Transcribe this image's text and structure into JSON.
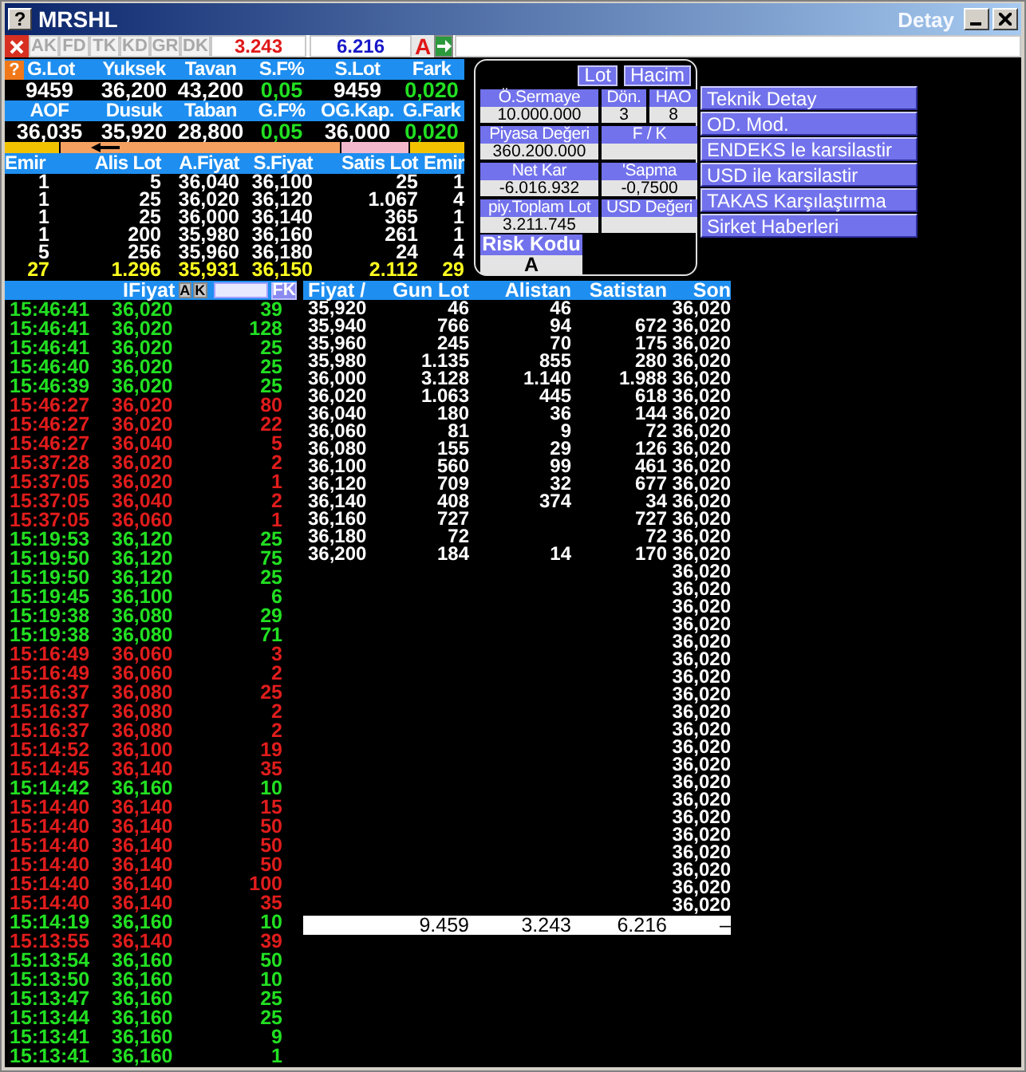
{
  "window": {
    "help": "?",
    "title": "MRSHL",
    "subtitle": "Detay"
  },
  "toolbar": {
    "tabs": [
      {
        "label": "AK",
        "disabled": true
      },
      {
        "label": "FD",
        "disabled": true
      },
      {
        "label": "TK",
        "disabled": true
      },
      {
        "label": "KD",
        "disabled": true
      },
      {
        "label": "GR",
        "disabled": true
      },
      {
        "label": "DK",
        "disabled": true
      }
    ],
    "bid_total": "3.243",
    "ask_total": "6.216",
    "mode": "A"
  },
  "quote": {
    "help": "?",
    "rows": [
      [
        {
          "label": "G.Lot",
          "value": "9459",
          "kind": "plain"
        },
        {
          "label": "Yuksek",
          "value": "36,200",
          "kind": "plain"
        },
        {
          "label": "Tavan",
          "value": "43,200",
          "kind": "plain"
        },
        {
          "label": "S.F%",
          "value": "0,05",
          "kind": "change"
        },
        {
          "label": "S.Lot",
          "value": "9459",
          "kind": "plain"
        },
        {
          "label": "Fark",
          "value": "0,020",
          "kind": "change"
        }
      ],
      [
        {
          "label": "AOF",
          "value": "36,035",
          "kind": "plain"
        },
        {
          "label": "Dusuk",
          "value": "35,920",
          "kind": "plain"
        },
        {
          "label": "Taban",
          "value": "28,800",
          "kind": "plain"
        },
        {
          "label": "G.F%",
          "value": "0,05",
          "kind": "change"
        },
        {
          "label": "OG.Kap.",
          "value": "36,000",
          "kind": "plain"
        },
        {
          "label": "G.Fark",
          "value": "0,020",
          "kind": "change"
        }
      ]
    ]
  },
  "order_book": {
    "columns": [
      "Emir",
      "Alis Lot",
      "A.Fiyat",
      "S.Fiyat",
      "Satis Lot",
      "Emir"
    ],
    "rows": [
      [
        "1",
        "5",
        "36,040",
        "36,100",
        "25",
        "1"
      ],
      [
        "1",
        "25",
        "36,020",
        "36,120",
        "1.067",
        "4"
      ],
      [
        "1",
        "25",
        "36,000",
        "36,140",
        "365",
        "1"
      ],
      [
        "1",
        "200",
        "35,980",
        "36,160",
        "261",
        "1"
      ],
      [
        "5",
        "256",
        "35,960",
        "36,180",
        "24",
        "4"
      ]
    ],
    "totals": [
      "27",
      "1.296",
      "35,931",
      "36,150",
      "2.112",
      "29"
    ]
  },
  "info": {
    "toggles": [
      "Lot",
      "Hacim"
    ],
    "fields": [
      {
        "label": "Ö.Sermaye",
        "value": "10.000.000"
      },
      {
        "label": "Dön.",
        "value": "3"
      },
      {
        "label": "HAO",
        "value": "8"
      },
      {
        "label": "Piyasa Değeri",
        "value": "360.200.000"
      },
      {
        "label": "F / K"
      },
      {
        "label": "Net Kar",
        "value": "-6.016.932"
      },
      {
        "label": "'Sapma",
        "value": "-0,7500"
      },
      {
        "label": "piy.Toplam Lot",
        "value": "3.211.745"
      },
      {
        "label": "USD Değeri"
      }
    ],
    "risk": {
      "label": "Risk Kodu",
      "value": "A"
    }
  },
  "links": [
    "Teknik Detay",
    "OD. Mod.",
    "ENDEKS le karsilastir",
    "USD ile karsilastir",
    "TAKAS Karşılaştırma",
    "Sirket Haberleri"
  ],
  "trades": {
    "header": {
      "label": "IFiyat",
      "buttons": [
        "A",
        "K"
      ],
      "filter": "FK"
    },
    "rows": [
      {
        "time": "15:46:41",
        "price": "36,020",
        "lot": "39",
        "buy": true
      },
      {
        "time": "15:46:41",
        "price": "36,020",
        "lot": "128",
        "buy": true
      },
      {
        "time": "15:46:41",
        "price": "36,020",
        "lot": "25",
        "buy": true
      },
      {
        "time": "15:46:40",
        "price": "36,020",
        "lot": "25",
        "buy": true
      },
      {
        "time": "15:46:39",
        "price": "36,020",
        "lot": "25",
        "buy": true
      },
      {
        "time": "15:46:27",
        "price": "36,020",
        "lot": "80",
        "buy": false
      },
      {
        "time": "15:46:27",
        "price": "36,020",
        "lot": "22",
        "buy": false
      },
      {
        "time": "15:46:27",
        "price": "36,040",
        "lot": "5",
        "buy": false
      },
      {
        "time": "15:37:28",
        "price": "36,020",
        "lot": "2",
        "buy": false
      },
      {
        "time": "15:37:05",
        "price": "36,020",
        "lot": "1",
        "buy": false
      },
      {
        "time": "15:37:05",
        "price": "36,040",
        "lot": "2",
        "buy": false
      },
      {
        "time": "15:37:05",
        "price": "36,060",
        "lot": "1",
        "buy": false
      },
      {
        "time": "15:19:53",
        "price": "36,120",
        "lot": "25",
        "buy": true
      },
      {
        "time": "15:19:50",
        "price": "36,120",
        "lot": "75",
        "buy": true
      },
      {
        "time": "15:19:50",
        "price": "36,120",
        "lot": "25",
        "buy": true
      },
      {
        "time": "15:19:45",
        "price": "36,100",
        "lot": "6",
        "buy": true
      },
      {
        "time": "15:19:38",
        "price": "36,080",
        "lot": "29",
        "buy": true
      },
      {
        "time": "15:19:38",
        "price": "36,080",
        "lot": "71",
        "buy": true
      },
      {
        "time": "15:16:49",
        "price": "36,060",
        "lot": "3",
        "buy": false
      },
      {
        "time": "15:16:49",
        "price": "36,060",
        "lot": "2",
        "buy": false
      },
      {
        "time": "15:16:37",
        "price": "36,080",
        "lot": "25",
        "buy": false
      },
      {
        "time": "15:16:37",
        "price": "36,080",
        "lot": "2",
        "buy": false
      },
      {
        "time": "15:16:37",
        "price": "36,080",
        "lot": "2",
        "buy": false
      },
      {
        "time": "15:14:52",
        "price": "36,100",
        "lot": "19",
        "buy": false
      },
      {
        "time": "15:14:45",
        "price": "36,140",
        "lot": "35",
        "buy": false
      },
      {
        "time": "15:14:42",
        "price": "36,160",
        "lot": "10",
        "buy": true
      },
      {
        "time": "15:14:40",
        "price": "36,140",
        "lot": "15",
        "buy": false
      },
      {
        "time": "15:14:40",
        "price": "36,140",
        "lot": "50",
        "buy": false
      },
      {
        "time": "15:14:40",
        "price": "36,140",
        "lot": "50",
        "buy": false
      },
      {
        "time": "15:14:40",
        "price": "36,140",
        "lot": "50",
        "buy": false
      },
      {
        "time": "15:14:40",
        "price": "36,140",
        "lot": "100",
        "buy": false
      },
      {
        "time": "15:14:40",
        "price": "36,140",
        "lot": "35",
        "buy": false
      },
      {
        "time": "15:14:19",
        "price": "36,160",
        "lot": "10",
        "buy": true
      },
      {
        "time": "15:13:55",
        "price": "36,140",
        "lot": "39",
        "buy": false
      },
      {
        "time": "15:13:54",
        "price": "36,160",
        "lot": "50",
        "buy": true
      },
      {
        "time": "15:13:50",
        "price": "36,160",
        "lot": "10",
        "buy": true
      },
      {
        "time": "15:13:47",
        "price": "36,160",
        "lot": "25",
        "buy": true
      },
      {
        "time": "15:13:44",
        "price": "36,160",
        "lot": "25",
        "buy": true
      },
      {
        "time": "15:13:41",
        "price": "36,160",
        "lot": "9",
        "buy": true
      },
      {
        "time": "15:13:41",
        "price": "36,160",
        "lot": "1",
        "buy": true
      }
    ]
  },
  "depth": {
    "columns": [
      "Fiyat /",
      "Gun Lot",
      "Alistan",
      "Satistan",
      "Son"
    ],
    "rows": [
      {
        "price": "35,920",
        "gun_lot": "46",
        "alistan": "46",
        "son": "36,020"
      },
      {
        "price": "35,940",
        "gun_lot": "766",
        "alistan": "94",
        "satistan": "672",
        "son": "36,020"
      },
      {
        "price": "35,960",
        "gun_lot": "245",
        "alistan": "70",
        "satistan": "175",
        "son": "36,020"
      },
      {
        "price": "35,980",
        "gun_lot": "1.135",
        "alistan": "855",
        "satistan": "280",
        "son": "36,020"
      },
      {
        "price": "36,000",
        "gun_lot": "3.128",
        "alistan": "1.140",
        "satistan": "1.988",
        "son": "36,020"
      },
      {
        "price": "36,020",
        "gun_lot": "1.063",
        "alistan": "445",
        "satistan": "618",
        "son": "36,020"
      },
      {
        "price": "36,040",
        "gun_lot": "180",
        "alistan": "36",
        "satistan": "144",
        "son": "36,020"
      },
      {
        "price": "36,060",
        "gun_lot": "81",
        "alistan": "9",
        "satistan": "72",
        "son": "36,020"
      },
      {
        "price": "36,080",
        "gun_lot": "155",
        "alistan": "29",
        "satistan": "126",
        "son": "36,020"
      },
      {
        "price": "36,100",
        "gun_lot": "560",
        "alistan": "99",
        "satistan": "461",
        "son": "36,020"
      },
      {
        "price": "36,120",
        "gun_lot": "709",
        "alistan": "32",
        "satistan": "677",
        "son": "36,020"
      },
      {
        "price": "36,140",
        "gun_lot": "408",
        "alistan": "374",
        "satistan": "34",
        "son": "36,020"
      },
      {
        "price": "36,160",
        "gun_lot": "727",
        "satistan": "727",
        "son": "36,020"
      },
      {
        "price": "36,180",
        "gun_lot": "72",
        "satistan": "72",
        "son": "36,020"
      },
      {
        "price": "36,200",
        "gun_lot": "184",
        "alistan": "14",
        "satistan": "170",
        "son": "36,020"
      },
      {
        "son": "36,020"
      },
      {
        "son": "36,020"
      },
      {
        "son": "36,020"
      },
      {
        "son": "36,020"
      },
      {
        "son": "36,020"
      },
      {
        "son": "36,020"
      },
      {
        "son": "36,020"
      },
      {
        "son": "36,020"
      },
      {
        "son": "36,020"
      },
      {
        "son": "36,020"
      },
      {
        "son": "36,020"
      },
      {
        "son": "36,020"
      },
      {
        "son": "36,020"
      },
      {
        "son": "36,020"
      },
      {
        "son": "36,020"
      },
      {
        "son": "36,020"
      },
      {
        "son": "36,020"
      },
      {
        "son": "36,020"
      },
      {
        "son": "36,020"
      },
      {
        "son": "36,020"
      }
    ],
    "totals": {
      "gun_lot": "9.459",
      "alistan": "3.243",
      "satistan": "6.216",
      "son": "–"
    }
  }
}
